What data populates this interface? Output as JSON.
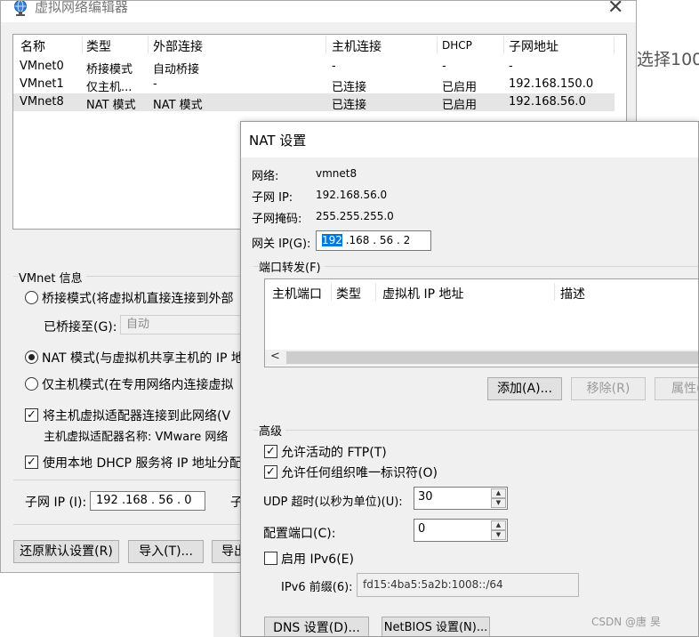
{
  "background": {
    "right_text": "选择100",
    "watermark": "CSDN @唐 昊"
  },
  "editor": {
    "title": "虚拟网络编辑器",
    "columns": [
      "名称",
      "类型",
      "外部连接",
      "主机连接",
      "DHCP",
      "子网地址"
    ],
    "rows": [
      [
        "VMnet0",
        "桥接模式",
        "自动桥接",
        "-",
        "-",
        "-"
      ],
      [
        "VMnet1",
        "仅主机...",
        "-",
        "已连接",
        "已启用",
        "192.168.150.0"
      ],
      [
        "VMnet8",
        "NAT 模式",
        "NAT 模式",
        "已连接",
        "已启用",
        "192.168.56.0"
      ]
    ],
    "selected_row": 2,
    "vmnet_info_label": "VMnet 信息",
    "bridged_radio": "桥接模式(将虚拟机直接连接到外部",
    "bridged_to_label": "已桥接至(G):",
    "bridged_to_value": "自动",
    "nat_radio": "NAT 模式(与虚拟机共享主机的 IP 地",
    "hostonly_radio": "仅主机模式(在专用网络内连接虚拟",
    "mode": "nat",
    "connect_adapter_check": "将主机虚拟适配器连接到此网络(V",
    "connect_adapter_checked": true,
    "adapter_name_text": "主机虚拟适配器名称: VMware 网络",
    "dhcp_check": "使用本地 DHCP 服务将 IP 地址分配",
    "dhcp_checked": true,
    "subnet_ip_label": "子网 IP (I):",
    "subnet_ip_value": "192 .168 . 56  .  0",
    "subnet_mask_label_partial": "子",
    "restore_button": "还原默认设置(R)",
    "import_button": "导入(T)...",
    "export_button_partial": "导出"
  },
  "nat": {
    "title": "NAT 设置",
    "network_label": "网络:",
    "network_value": "vmnet8",
    "subnet_ip_label": "子网 IP:",
    "subnet_ip_value": "192.168.56.0",
    "subnet_mask_label": "子网掩码:",
    "subnet_mask_value": "255.255.255.0",
    "gateway_label": "网关 IP(G):",
    "gateway_first": "192",
    "gateway_rest": " .168 . 56  .  2",
    "port_forwarding_label": "端口转发(F)",
    "pf_columns": [
      "主机端口",
      "类型",
      "虚拟机 IP 地址",
      "描述"
    ],
    "add_button": "添加(A)...",
    "remove_button": "移除(R)",
    "properties_button": "属性(",
    "advanced_label": "高级",
    "allow_ftp": "允许活动的 FTP(T)",
    "allow_ftp_checked": true,
    "allow_oui": "允许任何组织唯一标识符(O)",
    "allow_oui_checked": true,
    "udp_timeout_label": "UDP 超时(以秒为单位)(U):",
    "udp_timeout_value": "30",
    "config_port_label": "配置端口(C):",
    "config_port_value": "0",
    "enable_ipv6": "启用 IPv6(E)",
    "enable_ipv6_checked": false,
    "ipv6_prefix_label": "IPv6 前缀(6):",
    "ipv6_prefix_value": "fd15:4ba5:5a2b:1008::/64",
    "dns_button": "DNS 设置(D)...",
    "netbios_button": "NetBIOS 设置(N)..."
  }
}
